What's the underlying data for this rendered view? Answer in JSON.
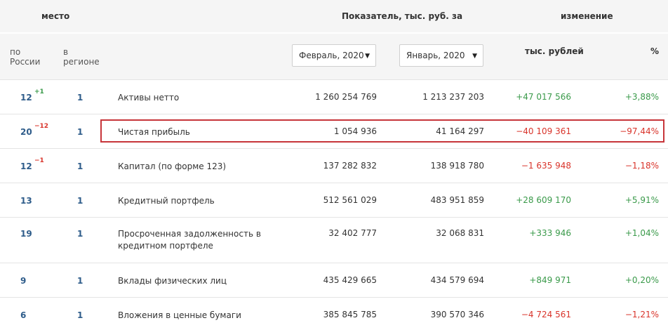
{
  "header": {
    "place_title": "место",
    "indicator_title": "Показатель, тыс. руб. за",
    "change_title": "изменение",
    "by_russia": [
      "по",
      "России"
    ],
    "in_region": [
      "в",
      "регионе"
    ],
    "period1": {
      "selected": "Февраль, 2020",
      "arrow": "▼"
    },
    "period2": {
      "selected": "Январь, 2020",
      "arrow": "▼"
    },
    "change_abs": "тыс. рублей",
    "change_pct": "%"
  },
  "rows": [
    {
      "rank": "12",
      "rank_delta": "+1",
      "delta_sign": "pos",
      "region": "1",
      "name": [
        "Активы нетто"
      ],
      "v1": "1 260 254 769",
      "v2": "1 213 237 203",
      "d_abs": "+47 017 566",
      "d_pct": "+3,88%",
      "sign": "pos"
    },
    {
      "rank": "20",
      "rank_delta": "−12",
      "delta_sign": "neg",
      "region": "1",
      "name": [
        "Чистая прибыль"
      ],
      "v1": "1 054 936",
      "v2": "41 164 297",
      "d_abs": "−40 109 361",
      "d_pct": "−97,44%",
      "sign": "neg"
    },
    {
      "rank": "12",
      "rank_delta": "−1",
      "delta_sign": "neg",
      "region": "1",
      "name": [
        "Капитал (по форме 123)"
      ],
      "v1": "137 282 832",
      "v2": "138 918 780",
      "d_abs": "−1 635 948",
      "d_pct": "−1,18%",
      "sign": "neg"
    },
    {
      "rank": "13",
      "rank_delta": "",
      "delta_sign": "",
      "region": "1",
      "name": [
        "Кредитный портфель"
      ],
      "v1": "512 561 029",
      "v2": "483 951 859",
      "d_abs": "+28 609 170",
      "d_pct": "+5,91%",
      "sign": "pos"
    },
    {
      "rank": "19",
      "rank_delta": "",
      "delta_sign": "",
      "region": "1",
      "name": [
        "Просроченная задолженность в",
        "кредитном портфеле"
      ],
      "v1": "32 402 777",
      "v2": "32 068 831",
      "d_abs": "+333 946",
      "d_pct": "+1,04%",
      "sign": "pos"
    },
    {
      "rank": "9",
      "rank_delta": "",
      "delta_sign": "",
      "region": "1",
      "name": [
        "Вклады физических лиц"
      ],
      "v1": "435 429 665",
      "v2": "434 579 694",
      "d_abs": "+849 971",
      "d_pct": "+0,20%",
      "sign": "pos"
    },
    {
      "rank": "6",
      "rank_delta": "",
      "delta_sign": "",
      "region": "1",
      "name": [
        "Вложения в ценные бумаги"
      ],
      "v1": "385 845 785",
      "v2": "390 570 346",
      "d_abs": "−4 724 561",
      "d_pct": "−1,21%",
      "sign": "neg"
    }
  ],
  "colors": {
    "positive": "#3a9a4a",
    "negative": "#d9342b",
    "rank": "#2e5c8a",
    "highlight_border": "#c7353a"
  }
}
